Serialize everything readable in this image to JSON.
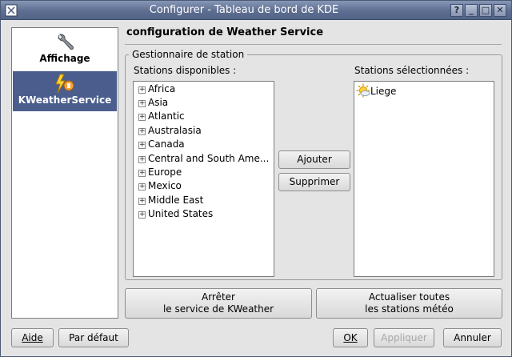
{
  "window": {
    "title": "Configurer - Tableau de bord de KDE",
    "buttons": {
      "help": "?",
      "minimize": "_",
      "maximize": "□",
      "close": "✕"
    }
  },
  "sidebar": {
    "items": [
      {
        "label": "Affichage",
        "icon": "wrench-icon",
        "selected": false
      },
      {
        "label": "KWeatherService",
        "icon": "weather-service-icon",
        "selected": true
      }
    ]
  },
  "content": {
    "title": "configuration de Weather Service",
    "group_title": "Gestionnaire de station",
    "available_label": "Stations disponibles :",
    "selected_label": "Stations sélectionnées :",
    "available_stations": [
      "Africa",
      "Asia",
      "Atlantic",
      "Australasia",
      "Canada",
      "Central and South Ame...",
      "Europe",
      "Mexico",
      "Middle East",
      "United States"
    ],
    "selected_stations": [
      {
        "label": "Liege",
        "icon": "weather-sun-icon"
      }
    ],
    "add_button": "Ajouter",
    "remove_button": "Supprimer",
    "stop_button": {
      "line1": "Arrêter",
      "line2": "le service de KWeather"
    },
    "refresh_button": {
      "line1": "Actualiser toutes",
      "line2": "les stations météo"
    }
  },
  "footer": {
    "help": "Aide",
    "defaults": "Par défaut",
    "ok": "OK",
    "apply": "Appliquer",
    "cancel": "Annuler"
  },
  "colors": {
    "titlebar": "#5d6e90",
    "selection": "#4b5d8d",
    "background": "#e4e4e4"
  }
}
